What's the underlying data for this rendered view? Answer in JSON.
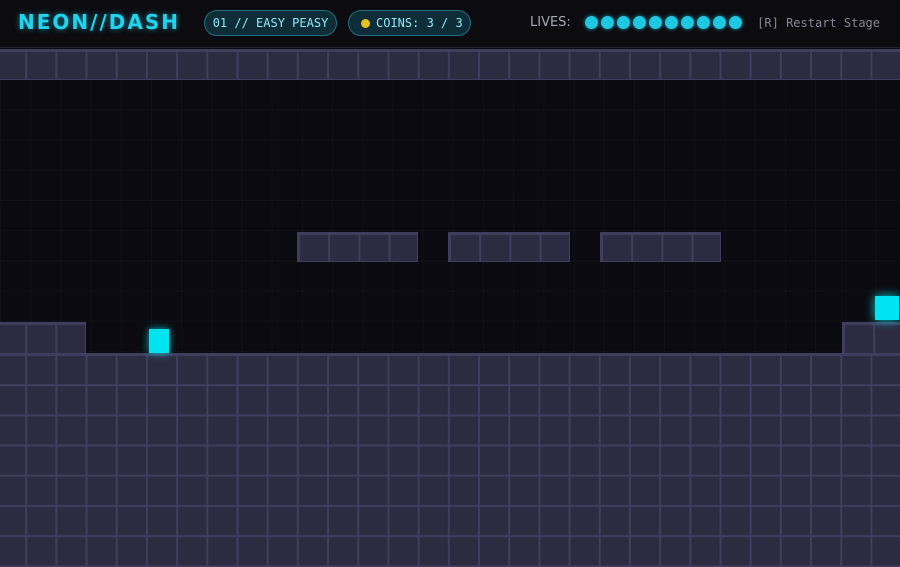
{
  "hud": {
    "logo": "NEON//DASH",
    "level": "01 // EASY PEASY",
    "coins_label": "COINS: 3 / 3",
    "lives_label": "LIVES:",
    "lives_count": 10,
    "restart_hint": "[R] Restart Stage"
  },
  "colors": {
    "accent": "#22d3ee",
    "player": "#00e4f2",
    "coin": "#e8c21c",
    "tile": "#2d2b42",
    "tile_border": "#403d5e"
  }
}
